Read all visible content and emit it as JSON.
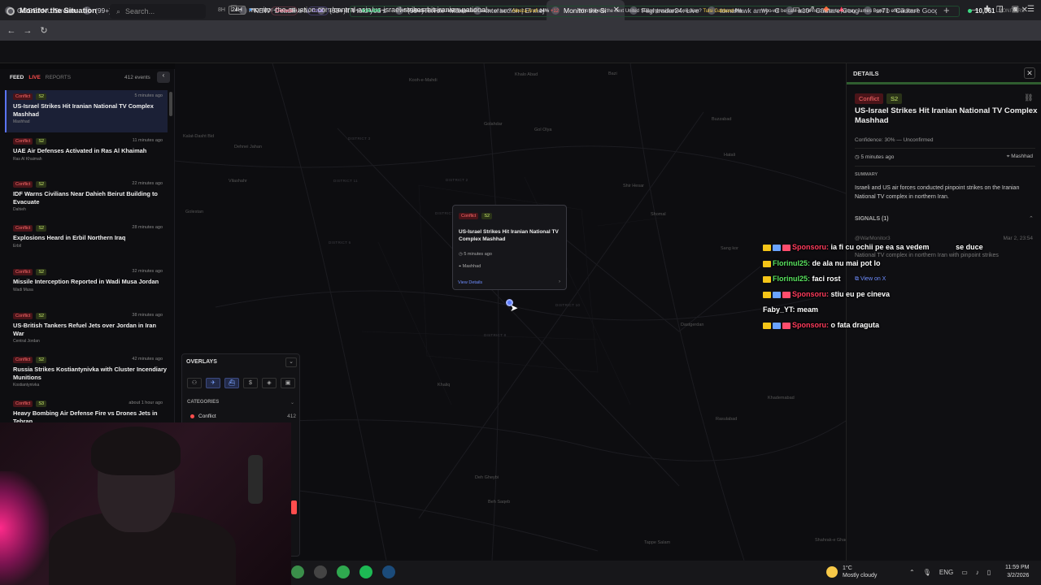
{
  "browser": {
    "tabs": [
      {
        "label": "GODEANU Stream",
        "active": false
      },
      {
        "label": "(99+)TikTok - Make",
        "active": false
      },
      {
        "label": "New Tab",
        "active": false
      },
      {
        "label": "*NEW* Deadline M",
        "active": false
      },
      {
        "label": "(99+)If 'I told you s",
        "active": false
      },
      {
        "label": "(99+)TikTok - Make",
        "active": false
      },
      {
        "label": "Interacción | El mej",
        "active": false
      },
      {
        "label": "Monitor the Si",
        "active": true
      },
      {
        "label": "Flightradar24: Live",
        "active": false
      },
      {
        "label": "tomahawk army - C",
        "active": false
      },
      {
        "label": "a10 - Căutare Goog",
        "active": false
      },
      {
        "label": "sr71 - Căutare Goog",
        "active": false
      }
    ],
    "new_tab": "+",
    "url": "monitor-the-situation.com/central-asia/us-israel-strikes-hit-iranian-national"
  },
  "header": {
    "logo": "Monitor the Situation",
    "search_placeholder": "Search...",
    "time_options": [
      "8H",
      "24H"
    ],
    "time_selected": "24H",
    "donate": "Donate",
    "chat": "Chat",
    "ticker": {
      "source": "KALSHI",
      "items": [
        {
          "question": "Who will become the next Supreme Leader of Iran?",
          "name": "Alireza Arafi",
          "pct": "24%",
          "delta": "+12"
        },
        {
          "question": "Who will win the next United States presidential election?",
          "name": "Tulsi Gabbard",
          "pct": "0%",
          "delta": ""
        },
        {
          "question": "Who will be cast as the next actor to portray James Bond in official films?",
          "name": "",
          "pct": "",
          "delta": ""
        }
      ]
    },
    "monitors_count": "10,061",
    "monitors_label": "MONITORS"
  },
  "feed": {
    "title": "FEED",
    "live": "LIVE",
    "reports": "REPORTS",
    "count": "412 events",
    "collapse": "‹",
    "items": [
      {
        "cat": "Conflict",
        "sev": "S2",
        "time": "5 minutes ago",
        "title": "US-Israel Strikes Hit Iranian National TV Complex Mashhad",
        "loc": "Mashhad"
      },
      {
        "cat": "Conflict",
        "sev": "S2",
        "time": "11 minutes ago",
        "title": "UAE Air Defenses Activated in Ras Al Khaimah",
        "loc": "Ras Al Khaimah"
      },
      {
        "cat": "Conflict",
        "sev": "S2",
        "time": "22 minutes ago",
        "title": "IDF Warns Civilians Near Dahieh Beirut Building to Evacuate",
        "loc": "Dahieh"
      },
      {
        "cat": "Conflict",
        "sev": "S2",
        "time": "28 minutes ago",
        "title": "Explosions Heard in Erbil Northern Iraq",
        "loc": "Erbil"
      },
      {
        "cat": "Conflict",
        "sev": "S2",
        "time": "32 minutes ago",
        "title": "Missile Interception Reported in Wadi Musa Jordan",
        "loc": "Wadi Musa"
      },
      {
        "cat": "Conflict",
        "sev": "S2",
        "time": "38 minutes ago",
        "title": "US-British Tankers Refuel Jets over Jordan in Iran War",
        "loc": "Central Jordan"
      },
      {
        "cat": "Conflict",
        "sev": "S2",
        "time": "42 minutes ago",
        "title": "Russia Strikes Kostiantynivka with Cluster Incendiary Munitions",
        "loc": "Kostiantynivka"
      },
      {
        "cat": "Conflict",
        "sev": "S3",
        "time": "about 1 hour ago",
        "title": "Heavy Bombing Air Defense Fire vs Drones Jets in Tehran",
        "loc": ""
      }
    ]
  },
  "overlays": {
    "title": "OVERLAYS",
    "toggle": "⌄",
    "categories_title": "CATEGORIES",
    "category": {
      "name": "Conflict",
      "count": "412"
    }
  },
  "popup": {
    "cat": "Conflict",
    "sev": "S2",
    "title": "US-Israel Strikes Hit Iranian National TV Complex Mashhad",
    "time": "5 minutes ago",
    "loc": "Mashhad",
    "details_link": "View Details",
    "arrow": "›"
  },
  "map_labels": [
    {
      "text": "Kooh-e-Mahdi",
      "cls": "mlabel"
    },
    {
      "text": "Khalo Abad",
      "cls": "mlabel"
    },
    {
      "text": "Bazi",
      "cls": "mlabel"
    },
    {
      "text": "Kalat-Dasht Bid",
      "cls": "mlabel"
    },
    {
      "text": "Dehnei Jahan",
      "cls": "mlabel"
    },
    {
      "text": "Golestan",
      "cls": "mlabel"
    },
    {
      "text": "Vilashahr",
      "cls": "mlabel"
    },
    {
      "text": "Shir Hesar",
      "cls": "mlabel"
    },
    {
      "text": "Shomal",
      "cls": "mlabel"
    },
    {
      "text": "Sang kor",
      "cls": "mlabel"
    },
    {
      "text": "Dastgerdan",
      "cls": "mlabel"
    },
    {
      "text": "Khaliq",
      "cls": "mlabel"
    },
    {
      "text": "Golahdar",
      "cls": "mlabel"
    },
    {
      "text": "Khademabad",
      "cls": "mlabel"
    },
    {
      "text": "Rasulabad",
      "cls": "mlabel"
    },
    {
      "text": "Deh Gheybi",
      "cls": "mlabel"
    },
    {
      "text": "Beh Saqeb",
      "cls": "mlabel"
    },
    {
      "text": "Tappe Salam",
      "cls": "mlabel"
    },
    {
      "text": "Shahrak-e Ghadir",
      "cls": "mlabel"
    },
    {
      "text": "Hatali",
      "cls": "mlabel"
    },
    {
      "text": "Gol Olya",
      "cls": "mlabel"
    },
    {
      "text": "Buzzabad",
      "cls": "mlabel"
    },
    {
      "text": "DISTRICT 3",
      "cls": "mdistrict"
    },
    {
      "text": "DISTRICT 11",
      "cls": "mdistrict"
    },
    {
      "text": "DISTRICT 2",
      "cls": "mdistrict"
    },
    {
      "text": "DISTRICT 6",
      "cls": "mdistrict"
    },
    {
      "text": "DISTRICT 9",
      "cls": "mdistrict"
    },
    {
      "text": "DISTRICT 10",
      "cls": "mdistrict"
    },
    {
      "text": "DISTRICT 8",
      "cls": "mdistrict"
    },
    {
      "text": "DISTRICT 7",
      "cls": "mdistrict"
    }
  ],
  "details": {
    "header": "DETAILS",
    "close": "✕",
    "cat": "Conflict",
    "sev": "S2",
    "title": "US-Israel Strikes Hit Iranian National TV Complex Mashhad",
    "confidence": "Confidence: 30% — Unconfirmed",
    "time": "5 minutes ago",
    "loc": "Mashhad",
    "summary_title": "SUMMARY",
    "summary": "Israeli and US air forces conducted pinpoint strikes on the Iranian National TV complex in northern Iran.",
    "signals_title": "SIGNALS (1)",
    "signal_user": "@WarMonitor3",
    "signal_date": "Mar 2, 23:54",
    "signal_text": "National TV complex in northern Iran with pinpoint strikes",
    "view_x": "View on X"
  },
  "chat": [
    {
      "user": "Sponsoru:",
      "msg": " ia fi cu ochii pe ea sa vedem",
      "tail": "se duce",
      "type": "S"
    },
    {
      "user": "Florinul25:",
      "msg": " de ala nu mai pot lo",
      "tail": "",
      "type": "F"
    },
    {
      "user": "Florinul25:",
      "msg": " faci rost",
      "tail": "",
      "type": "F"
    },
    {
      "user": "Sponsoru:",
      "msg": " stiu eu pe cineva",
      "tail": "",
      "type": "S"
    },
    {
      "user": "Faby_YT:",
      "msg": " meam",
      "tail": "",
      "type": "Y"
    },
    {
      "user": "Sponsoru:",
      "msg": " o fata draguta",
      "tail": "",
      "type": "S"
    }
  ],
  "taskbar": {
    "temp": "1°C",
    "weather": "Mostly cloudy",
    "lang": "ENG",
    "time": "11:59 PM",
    "date": "3/2/2026"
  },
  "colors": {
    "accent": "#5b74ff",
    "conflict": "#ff4d4d",
    "live": "#3ddc84"
  }
}
